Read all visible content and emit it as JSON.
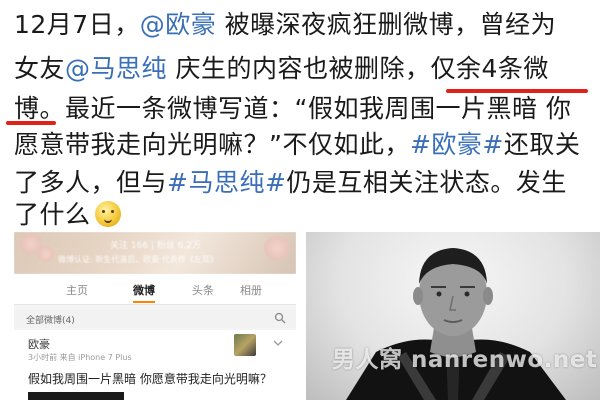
{
  "post": {
    "line1": {
      "date": "12月7日，",
      "mention": "@欧豪",
      "rest": " 被曝深夜疯狂删微博，曾经为"
    },
    "line2": {
      "prefix": "女友",
      "mention": "@马思纯",
      "rest": " 庆生的内容也被删除，",
      "highlight": "仅余4条微"
    },
    "line3": {
      "highlight": "博",
      "rest": "。最近一条微博写道：“假如我周围一片黑暗 你"
    },
    "line4": {
      "text": "愿意带我走向光明嘛？”不仅如此，",
      "tag": "#欧豪#",
      "rest": "还取关"
    },
    "line5": {
      "prefix": "了多人，但与",
      "tag": "#马思纯#",
      "rest": "仍是互相关注状态。发生"
    },
    "line6": {
      "text": "了什么",
      "emoji": "thinking-face-emoji"
    }
  },
  "screenshot": {
    "cover_stats": "关注 166  |  粉丝 6.2万",
    "cover_desc": "微博认证: 新生代演员、欧豪·代表作《左耳》",
    "tabs": [
      {
        "label": "主页",
        "active": false
      },
      {
        "label": "微博",
        "active": true
      },
      {
        "label": "头条",
        "active": false
      },
      {
        "label": "相册",
        "active": false
      }
    ],
    "filter_label": "全部微博(4)",
    "card": {
      "name": "欧豪",
      "meta": "3小时前  来自 iPhone 7 Plus",
      "text": "假如我周围一片黑暗 你愿意带我走向光明嘛？"
    }
  },
  "watermark": "男人窝 nanrenwo.net",
  "colors": {
    "link": "#3a6fb8",
    "underline": "#e0231a",
    "tab_indicator": "#ff8200"
  }
}
